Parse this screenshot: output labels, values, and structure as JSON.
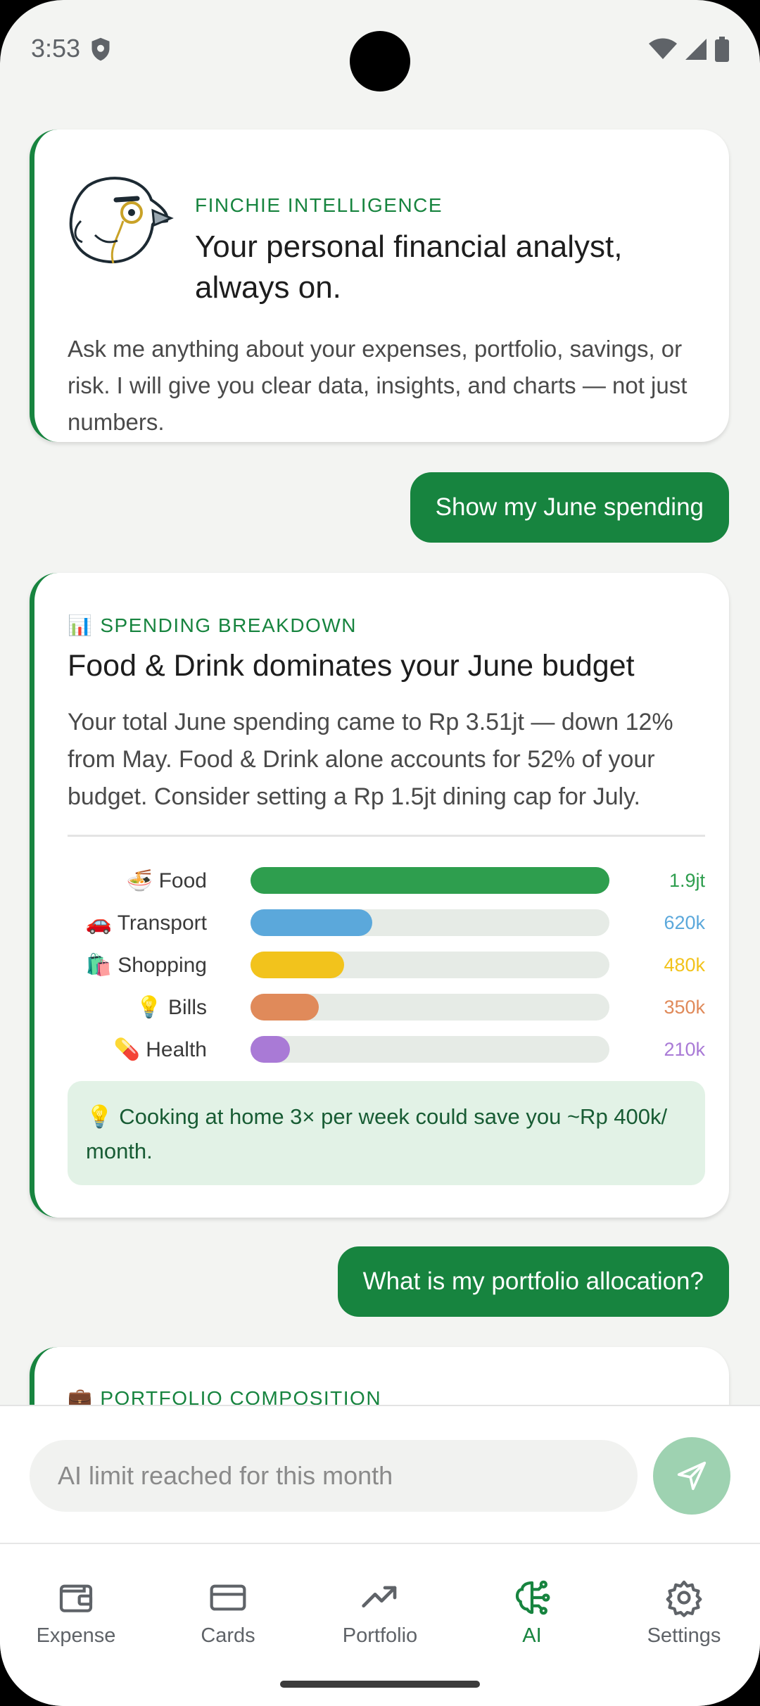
{
  "status_bar": {
    "time": "3:53"
  },
  "intro_card": {
    "eyebrow": "FINCHIE INTELLIGENCE",
    "title": "Your personal financial analyst, always on.",
    "body": "Ask me anything about your expenses, portfolio, savings, or risk. I will give you clear data, insights, and charts — not just numbers."
  },
  "messages": {
    "user_1": "Show my June spending",
    "user_2": "What is my portfolio allocation?"
  },
  "spending_card": {
    "eyebrow_icon": "📊",
    "eyebrow": "SPENDING BREAKDOWN",
    "title": "Food & Drink dominates your June budget",
    "body": "Your total June spending came to Rp 3.51jt — down 12% from May. Food & Drink alone accounts for 52% of your budget. Consider setting a Rp 1.5jt dining cap for July.",
    "tip": "💡 Cooking at home 3× per week could save you ~Rp 400k/ month."
  },
  "chart_data": {
    "type": "bar",
    "orientation": "horizontal",
    "categories": [
      "🍜 Food",
      "🚗 Transport",
      "🛍️ Shopping",
      "💡 Bills",
      "💊 Health"
    ],
    "value_labels": [
      "1.9jt",
      "620k",
      "480k",
      "350k",
      "210k"
    ],
    "values": [
      1.0,
      0.34,
      0.26,
      0.19,
      0.11
    ],
    "colors": [
      "#2e9e4e",
      "#5ba8db",
      "#f2c31c",
      "#e08a5a",
      "#a97ad6"
    ],
    "track_color": "#e6ebe6"
  },
  "portfolio_card": {
    "eyebrow_icon": "💼",
    "eyebrow": "PORTFOLIO COMPOSITION"
  },
  "composer": {
    "placeholder": "AI limit reached for this month",
    "send_icon": "send-icon"
  },
  "nav": {
    "items": [
      {
        "label": "Expense",
        "icon": "wallet-icon"
      },
      {
        "label": "Cards",
        "icon": "card-icon"
      },
      {
        "label": "Portfolio",
        "icon": "trend-icon"
      },
      {
        "label": "AI",
        "icon": "brain-icon"
      },
      {
        "label": "Settings",
        "icon": "gear-icon"
      }
    ],
    "active": "AI"
  },
  "colors": {
    "accent": "#17843f",
    "background": "#f3f4f2",
    "tip_bg": "#e2f2e6"
  }
}
